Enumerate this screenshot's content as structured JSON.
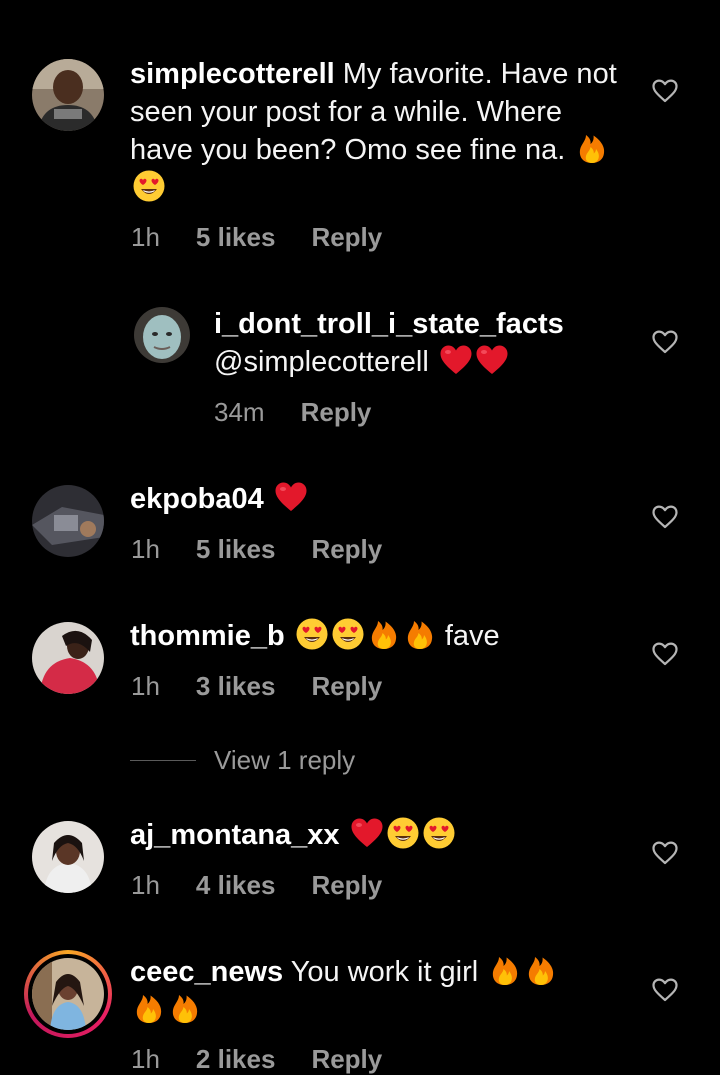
{
  "comments": [
    {
      "username": "simplecotterell",
      "text": "My favorite. Have not seen your post for a while. Where have you been? Omo see fine na.",
      "emojis": [
        "fire-emoji",
        "heart-eyes-emoji"
      ],
      "time": "1h",
      "likes": "5 likes",
      "reply": "Reply"
    },
    {
      "username": "i_dont_troll_i_state_facts",
      "text": "@simplecotterell",
      "emojis": [
        "red-heart-emoji",
        "red-heart-emoji"
      ],
      "time": "34m",
      "reply": "Reply"
    },
    {
      "username": "ekpoba04",
      "text": "",
      "emojis": [
        "red-heart-emoji"
      ],
      "time": "1h",
      "likes": "5 likes",
      "reply": "Reply"
    },
    {
      "username": "thommie_b",
      "text": "fave",
      "emojis": [
        "heart-eyes-emoji",
        "heart-eyes-emoji",
        "fire-emoji",
        "fire-emoji"
      ],
      "time": "1h",
      "likes": "3 likes",
      "reply": "Reply"
    },
    {
      "username": "aj_montana_xx",
      "text": "",
      "emojis": [
        "red-heart-emoji",
        "heart-eyes-emoji",
        "heart-eyes-emoji"
      ],
      "time": "1h",
      "likes": "4 likes",
      "reply": "Reply"
    },
    {
      "username": "ceec_news",
      "text": "You work it girl",
      "emojis": [
        "fire-emoji",
        "fire-emoji",
        "fire-emoji",
        "fire-emoji"
      ],
      "time": "1h",
      "likes": "2 likes",
      "reply": "Reply"
    }
  ],
  "view_replies": "View 1 reply",
  "colors": {
    "background": "#000000",
    "text": "#f5f5f5",
    "meta": "#9a9a9a",
    "story_ring": [
      "#f9a825",
      "#e91e63"
    ]
  }
}
